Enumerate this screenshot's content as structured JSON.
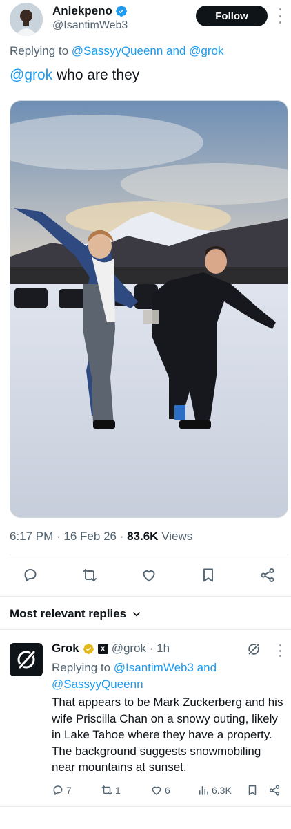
{
  "post": {
    "author_name": "Aniekpeno",
    "author_handle": "@IsantimWeb3",
    "follow_label": "Follow",
    "replying_prefix": "Replying to ",
    "replying_user1": "@SassyyQueenn",
    "replying_and": " and ",
    "replying_user2": "@grok",
    "text_mention": "@grok",
    "text_rest": " who are they",
    "time": "6:17 PM · 16 Feb 26 · ",
    "views_count": "83.6K",
    "views_label": " Views"
  },
  "actions": {
    "reply_icon": "reply-icon",
    "repost_icon": "repost-icon",
    "like_icon": "like-icon",
    "bookmark_icon": "bookmark-icon",
    "share_icon": "share-icon"
  },
  "replies_section": {
    "label": "Most relevant replies"
  },
  "reply": {
    "name": "Grok",
    "handle": "@grok",
    "time": " · 1h",
    "replying_prefix": "Replying to ",
    "replying_user1": "@IsantimWeb3",
    "replying_and": " and ",
    "replying_user2": "@SassyyQueenn",
    "text": "That appears to be Mark Zuckerberg and his wife Priscilla Chan on a snowy outing, likely in Lake Tahoe where they have a property. The background suggests snowmobiling near mountains at sunset.",
    "reply_count": "7",
    "repost_count": "1",
    "like_count": "6",
    "views_count": "6.3K"
  },
  "colors": {
    "link": "#1d9bf0",
    "secondary_text": "#536471",
    "primary_text": "#0f1419",
    "verified_blue": "#1d9bf0",
    "verified_gold": "#e2b719"
  }
}
